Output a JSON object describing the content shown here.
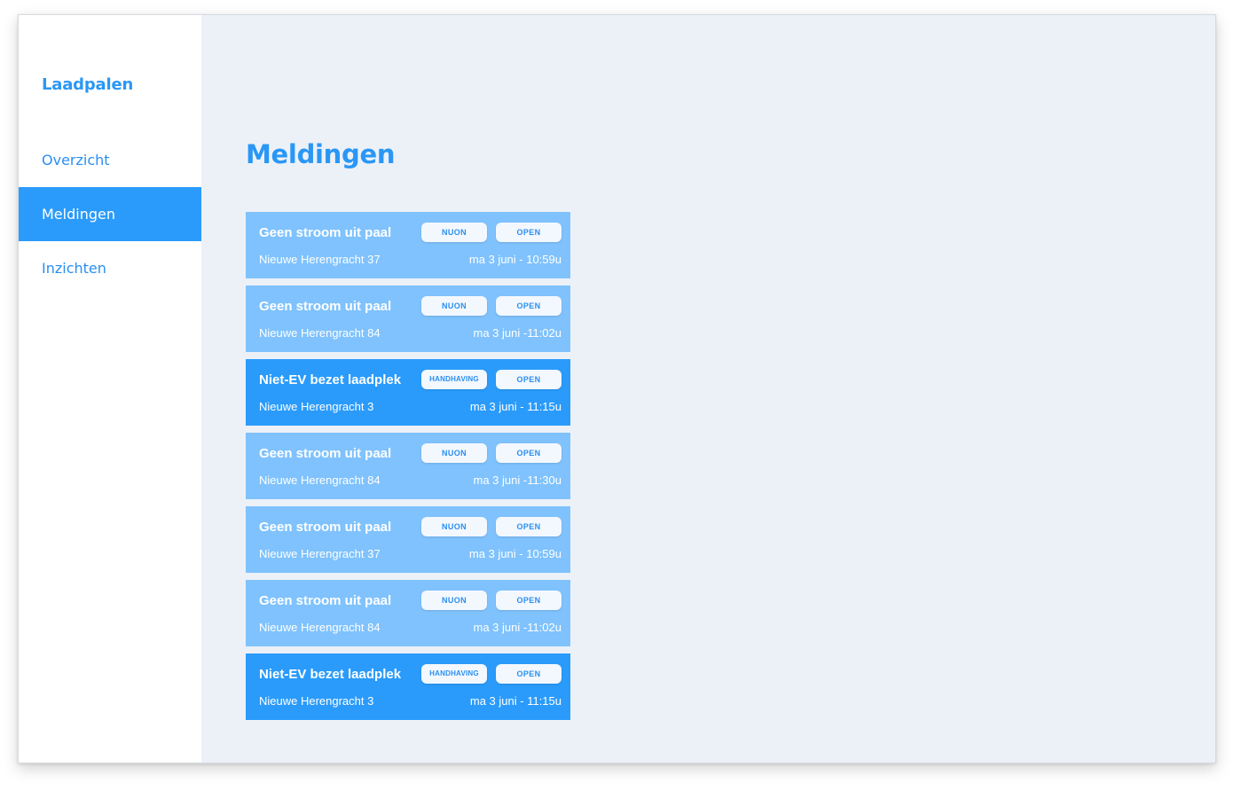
{
  "app": {
    "brand": "Laadpalen"
  },
  "sidebar": {
    "items": [
      {
        "label": "Overzicht",
        "active": false
      },
      {
        "label": "Meldingen",
        "active": true
      },
      {
        "label": "Inzichten",
        "active": false
      }
    ]
  },
  "main": {
    "title": "Meldingen",
    "notifications": [
      {
        "title": "Geen stroom uit paal",
        "org": "NUON",
        "status": "OPEN",
        "address": "Nieuwe Herengracht 37",
        "time": "ma 3 juni - 10:59u",
        "highlight": false
      },
      {
        "title": "Geen stroom uit paal",
        "org": "NUON",
        "status": "OPEN",
        "address": "Nieuwe Herengracht 84",
        "time": "ma 3 juni -11:02u",
        "highlight": false
      },
      {
        "title": "Niet-EV bezet laadplek",
        "org": "HANDHAVING",
        "status": "OPEN",
        "address": "Nieuwe Herengracht 3",
        "time": "ma 3 juni - 11:15u",
        "highlight": true
      },
      {
        "title": "Geen stroom uit paal",
        "org": "NUON",
        "status": "OPEN",
        "address": "Nieuwe Herengracht 84",
        "time": "ma 3 juni -11:30u",
        "highlight": false
      },
      {
        "title": "Geen stroom uit paal",
        "org": "NUON",
        "status": "OPEN",
        "address": "Nieuwe Herengracht 37",
        "time": "ma 3 juni - 10:59u",
        "highlight": false
      },
      {
        "title": "Geen stroom uit paal",
        "org": "NUON",
        "status": "OPEN",
        "address": "Nieuwe Herengracht 84",
        "time": "ma 3 juni -11:02u",
        "highlight": false
      },
      {
        "title": "Niet-EV bezet laadplek",
        "org": "HANDHAVING",
        "status": "OPEN",
        "address": "Nieuwe Herengracht 3",
        "time": "ma 3 juni - 11:15u",
        "highlight": true
      }
    ]
  },
  "colors": {
    "accent": "#2a9bfb",
    "card_light": "#7fc2fd",
    "background": "#ecf1f8",
    "pill_bg": "#f3f8fe"
  }
}
